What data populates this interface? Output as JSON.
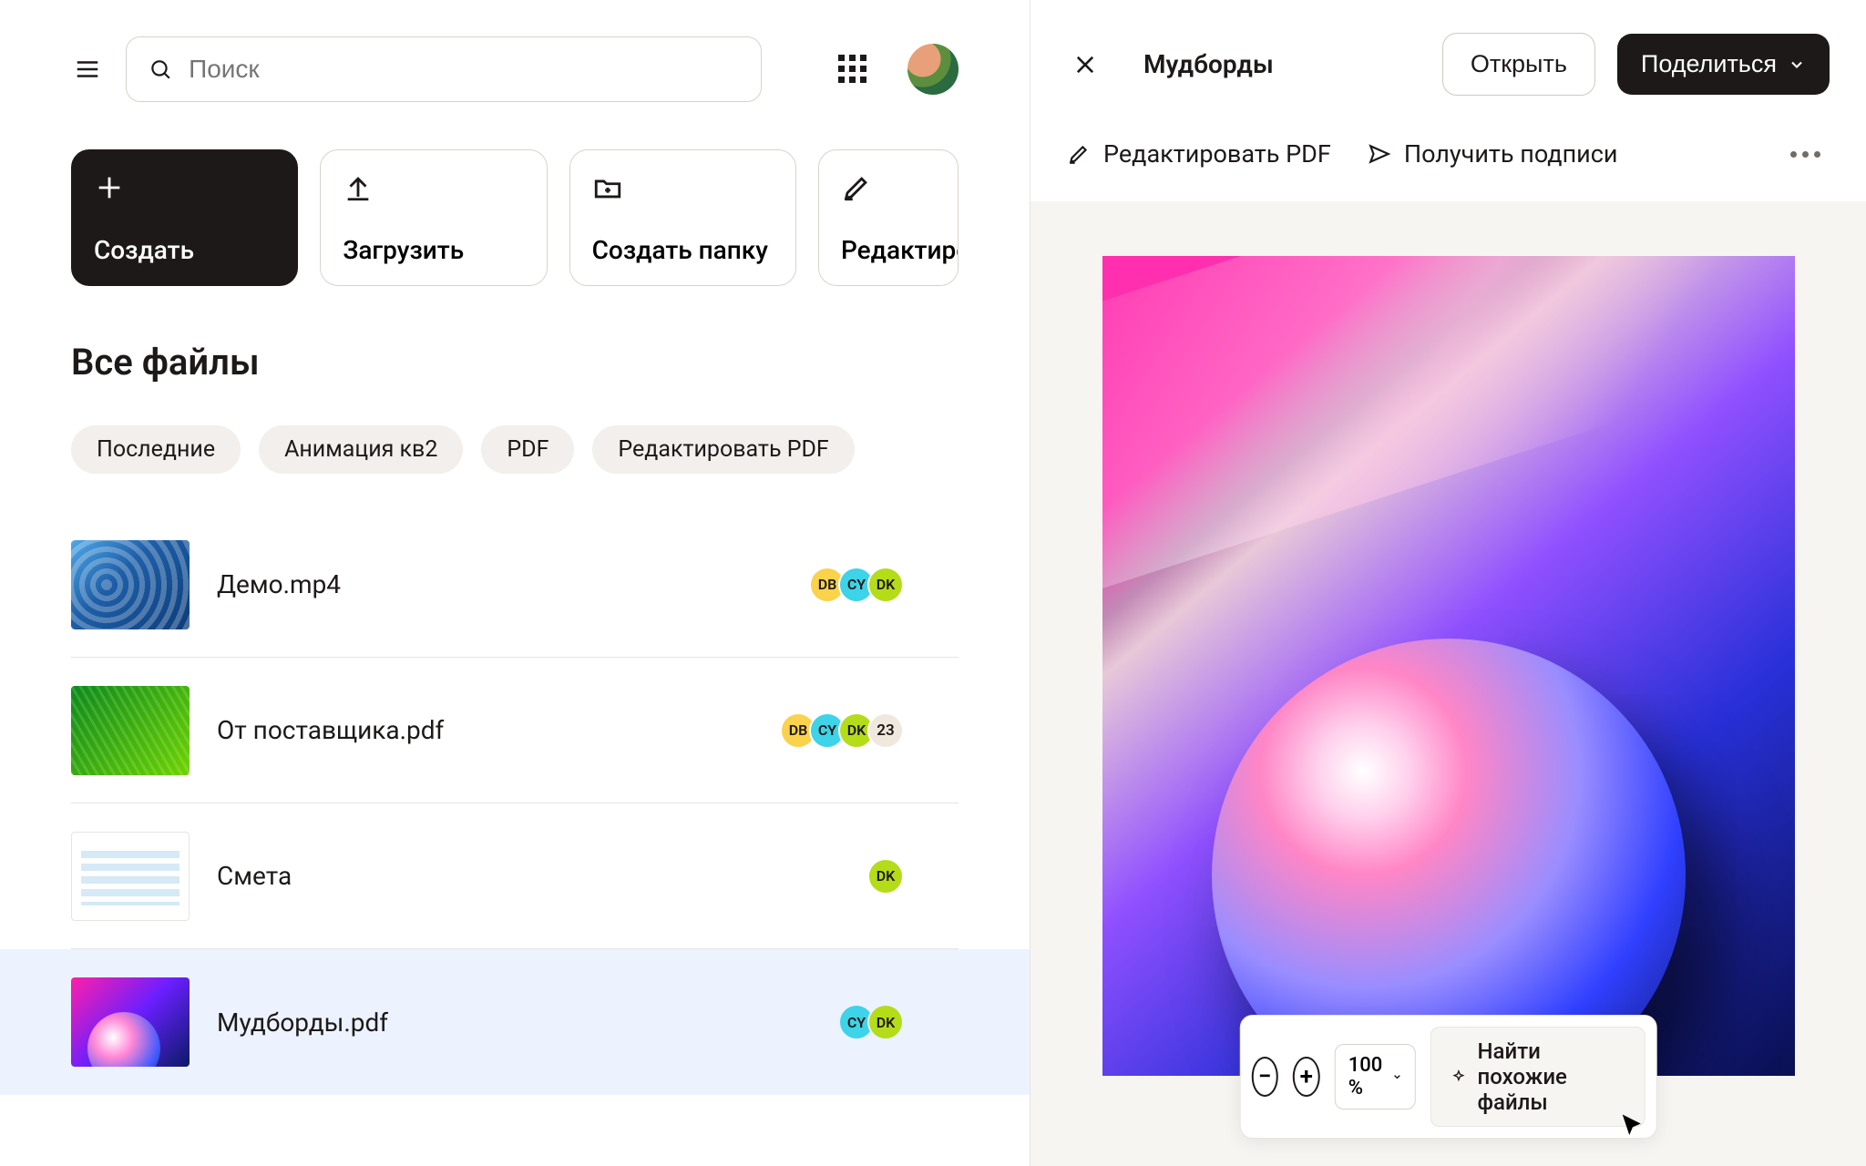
{
  "search": {
    "placeholder": "Поиск"
  },
  "actions": {
    "create": "Создать",
    "upload": "Загрузить",
    "create_folder": "Создать папку",
    "edit": "Редактиро"
  },
  "section_title": "Все файлы",
  "chips": [
    "Последние",
    "Анимация кв2",
    "PDF",
    "Редактировать PDF"
  ],
  "files": [
    {
      "name": "Демо.mp4",
      "avatars": [
        "DB",
        "CY",
        "DK"
      ],
      "extra": null
    },
    {
      "name": "От поставщика.pdf",
      "avatars": [
        "DB",
        "CY",
        "DK"
      ],
      "extra": "23"
    },
    {
      "name": "Смета",
      "avatars": [
        "DK"
      ],
      "extra": null
    },
    {
      "name": "Мудборды.pdf",
      "avatars": [
        "CY",
        "DK"
      ],
      "extra": null
    }
  ],
  "detail": {
    "title": "Мудборды",
    "open": "Открыть",
    "share": "Поделиться",
    "edit_pdf": "Редактировать PDF",
    "get_signatures": "Получить подписи",
    "zoom": "100 %",
    "find_similar": "Найти похожие файлы"
  },
  "avatar_colors": {
    "DB": "y",
    "CY": "b",
    "DK": "g"
  }
}
